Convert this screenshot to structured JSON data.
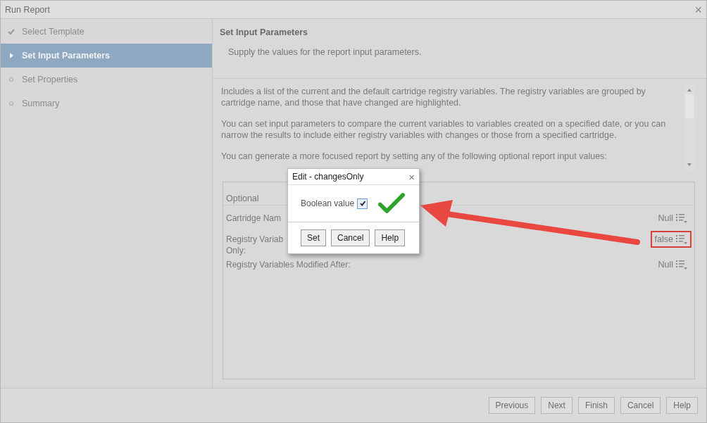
{
  "window": {
    "title": "Run Report",
    "close": "×"
  },
  "steps": [
    {
      "label": "Select Template",
      "kind": "done",
      "selected": false
    },
    {
      "label": "Set Input Parameters",
      "kind": "current",
      "selected": true
    },
    {
      "label": "Set Properties",
      "kind": "pending",
      "selected": false
    },
    {
      "label": "Summary",
      "kind": "pending",
      "selected": false
    }
  ],
  "page": {
    "title": "Set Input Parameters",
    "subtitle": "Supply the values for the report input parameters."
  },
  "description": [
    "Includes a list of the current and the default cartridge registry variables. The registry variables are grouped by cartridge name, and those that have changed are highlighted.",
    "You can set input parameters to compare the current variables to variables created on a specified date, or you can narrow the results to include either registry variables with changes or those from a specified cartridge.",
    "You can generate a more focused report by setting any of the following optional report input values:"
  ],
  "parameters": {
    "group": "Optional",
    "rows": [
      {
        "label": [
          "Cartridge Nam"
        ],
        "value": "Null",
        "highlighted": false
      },
      {
        "label": [
          "Registry Variab",
          "Only:"
        ],
        "value": "false",
        "highlighted": true
      },
      {
        "label": [
          "Registry Variables Modified After:"
        ],
        "value": "Null",
        "highlighted": false
      }
    ]
  },
  "dialog": {
    "title": "Edit - changesOnly",
    "close": "×",
    "field_label": "Boolean value",
    "checked": true,
    "buttons": [
      "Set",
      "Cancel",
      "Help"
    ]
  },
  "buttons": [
    "Previous",
    "Next",
    "Finish",
    "Cancel",
    "Help"
  ]
}
